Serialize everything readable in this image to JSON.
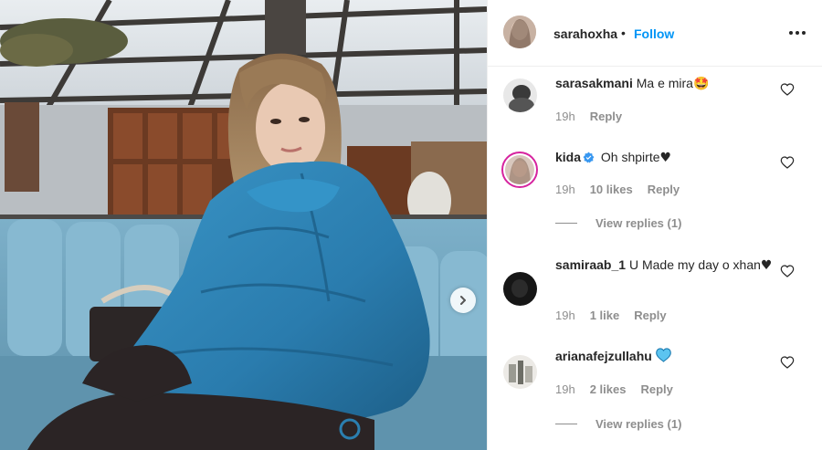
{
  "header": {
    "username": "sarahoxha",
    "separator": "•",
    "follow_label": "Follow"
  },
  "comments": [
    {
      "username": "sarasakmani",
      "text": "Ma e mira",
      "emoji": "🤩",
      "time": "19h",
      "likes": "",
      "reply_label": "Reply"
    },
    {
      "username": "kida",
      "text": "Oh shpirte",
      "emoji": "♥",
      "verified": true,
      "time": "19h",
      "likes": "10 likes",
      "reply_label": "Reply",
      "view_replies": "View replies (1)"
    },
    {
      "username": "samiraab_1",
      "text": "U Made my day o xhan",
      "emoji": "♥",
      "time": "19h",
      "likes": "1 like",
      "reply_label": "Reply"
    },
    {
      "username": "arianafejzullahu",
      "text": "",
      "emoji": "💙",
      "time": "19h",
      "likes": "2 likes",
      "reply_label": "Reply",
      "view_replies": "View replies (1)"
    }
  ],
  "colors": {
    "follow": "#0095f6",
    "secondary_text": "#8e8e8e",
    "verified": "#3897f0",
    "jacket": "#2b7fb0",
    "sofa": "#6fa3bd"
  },
  "icons": {
    "more": "more-options-icon",
    "heart": "heart-outline-icon",
    "next": "chevron-right-icon",
    "verified": "verified-badge-icon"
  }
}
